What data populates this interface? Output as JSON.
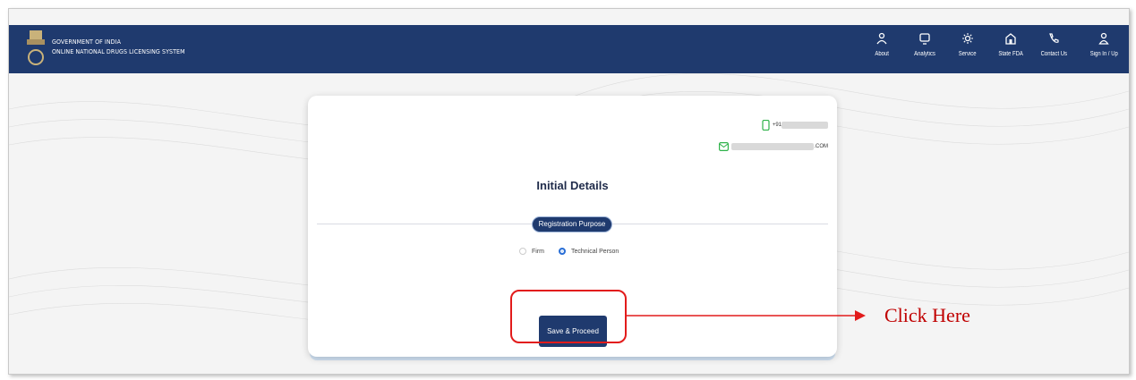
{
  "header": {
    "title_line1": "GOVERNMENT OF INDIA",
    "title_line2": "ONLINE NATIONAL DRUGS LICENSING SYSTEM",
    "nav": [
      {
        "label": "About",
        "icon": "person-icon"
      },
      {
        "label": "Analytics",
        "icon": "monitor-icon"
      },
      {
        "label": "Service",
        "icon": "gear-icon"
      },
      {
        "label": "State FDA",
        "icon": "building-icon"
      },
      {
        "label": "Contact Us",
        "icon": "phone-icon"
      },
      {
        "label": "Sign In / Up",
        "icon": "user-icon"
      }
    ]
  },
  "card": {
    "phone_prefix": "+91",
    "email_suffix": ".COM",
    "title": "Initial Details",
    "section_label": "Registration Purpose",
    "radio_options": [
      {
        "label": "Firm",
        "selected": false
      },
      {
        "label": "Technical Person",
        "selected": true
      }
    ],
    "save_label": "Save & Proceed"
  },
  "annotation": {
    "callout_text": "Click Here",
    "color": "#e21b1b"
  },
  "colors": {
    "header_bg": "#1f3a6e",
    "accent_blue": "#2a6fd6",
    "phone_icon": "#2fb24a"
  }
}
